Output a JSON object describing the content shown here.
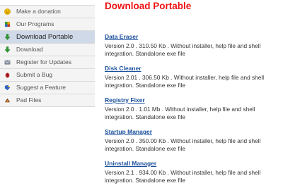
{
  "sidebar": {
    "items": [
      {
        "label": "Make a donation",
        "icon": "smiley-icon",
        "active": false
      },
      {
        "label": "Our Programs",
        "icon": "puzzle-icon",
        "active": false
      },
      {
        "label": "Download Portable",
        "icon": "download-arrow-icon",
        "active": true
      },
      {
        "label": "Download",
        "icon": "download-arrow-icon",
        "active": false
      },
      {
        "label": "Register for Updates",
        "icon": "register-icon",
        "active": false
      },
      {
        "label": "Submit a Bug",
        "icon": "bug-icon",
        "active": false
      },
      {
        "label": "Suggest a Feature",
        "icon": "feature-icon",
        "active": false
      },
      {
        "label": "Pad Files",
        "icon": "pad-files-icon",
        "active": false
      }
    ]
  },
  "main": {
    "title": "Download Portable",
    "downloads": [
      {
        "name": "Data Eraser",
        "description": "Version 2.0 . 310.50 Kb . Without installer, help file and shell integration. Standalone exe file"
      },
      {
        "name": "Disk Cleaner",
        "description": "Version 2.01 . 306.50 Kb . Without installer, help file and shell integration. Standalone exe file"
      },
      {
        "name": "Registry Fixer",
        "description": "Version 2.0 . 1.01 Mb . Without installer, help file and shell integration. Standalone exe file"
      },
      {
        "name": "Startup Manager",
        "description": "Version 2.0 . 350.00 Kb . Without installer, help file and shell integration. Standalone exe file"
      },
      {
        "name": "Uninstall Manager",
        "description": "Version 2.1 . 934.00 Kb . Without installer, help file and shell integration. Standalone exe file"
      }
    ]
  },
  "colors": {
    "title": "#ee1111",
    "link": "#1a4f9c",
    "active_item": "#cfd9e8",
    "sidebar_bg": "#f4f4f4"
  }
}
